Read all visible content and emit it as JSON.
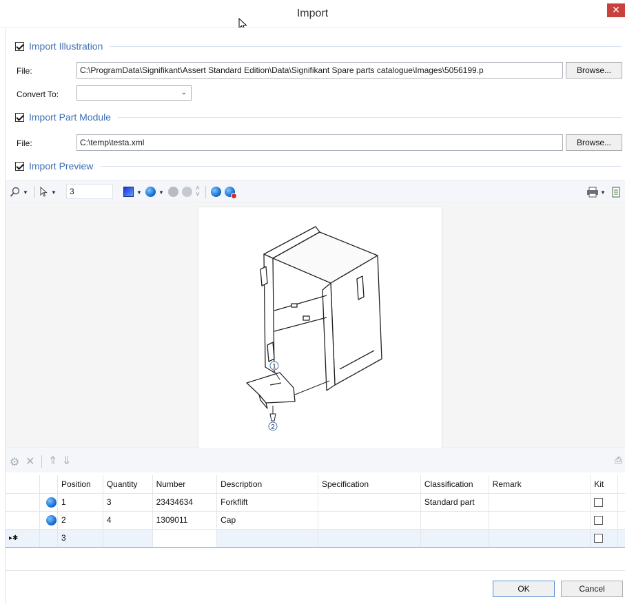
{
  "window": {
    "title": "Import",
    "close_glyph": "✕"
  },
  "illustration": {
    "group_label": "Import Illustration",
    "checked": true,
    "file_label": "File:",
    "file_value": "C:\\ProgramData\\Signifikant\\Assert Standard Edition\\Data\\Signifikant Spare parts catalogue\\Images\\5056199.p",
    "browse_label": "Browse...",
    "convert_label": "Convert To:",
    "convert_value": ""
  },
  "part_module": {
    "group_label": "Import Part Module",
    "checked": true,
    "file_label": "File:",
    "file_value": "C:\\temp\\testa.xml",
    "browse_label": "Browse..."
  },
  "preview": {
    "group_label": "Import Preview",
    "checked": true,
    "toolbar": {
      "position_value": "3",
      "icons": [
        "zoom-icon",
        "select-arrow-icon",
        "color-square-icon",
        "blue-ball-icon",
        "gray-balls-icon",
        "spinner-icon",
        "help-ball-icon",
        "remove-ball-icon",
        "print-icon"
      ]
    },
    "callouts": [
      "1",
      "2"
    ]
  },
  "grid": {
    "toolbar_icons": [
      "gear-icon",
      "delete-icon",
      "move-up-icon",
      "move-down-icon",
      "print-icon"
    ],
    "columns": [
      "Position",
      "Quantity",
      "Number",
      "Description",
      "Specification",
      "Classification",
      "Remark",
      "Kit"
    ],
    "rows": [
      {
        "position": "1",
        "quantity": "3",
        "number": "23434634",
        "description": "Forkflift",
        "specification": "",
        "classification": "Standard part",
        "remark": "",
        "kit": false
      },
      {
        "position": "2",
        "quantity": "4",
        "number": "1309011",
        "description": "Cap",
        "specification": "",
        "classification": "",
        "remark": "",
        "kit": false
      }
    ],
    "new_row": {
      "marker": "▸✱",
      "position": "3",
      "kit": false
    }
  },
  "footer": {
    "ok_label": "OK",
    "cancel_label": "Cancel"
  },
  "colors": {
    "accent": "#3e6fb4",
    "close": "#c8413a",
    "ball": "#0a64c8"
  }
}
